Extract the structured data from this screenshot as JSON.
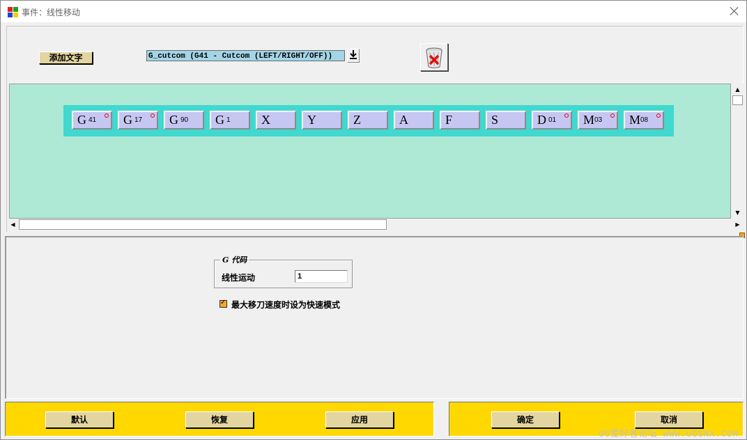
{
  "window": {
    "title": "事件：线性移动",
    "title_color": "#666666"
  },
  "toolbar": {
    "add_text_label": "添加文字",
    "dropdown_value": "G_cutcom (G41 - Cutcom (LEFT/RIGHT/OFF))",
    "dropdown_arrow_icon": "download-arrow-icon",
    "delete_icon": "trash-delete-icon"
  },
  "block": {
    "area_color": "#ade9d5",
    "strip_color": "#40d8cf",
    "word_color": "#c6c6f2",
    "words": [
      {
        "letter": "G",
        "sub": "41",
        "marked": true
      },
      {
        "letter": "G",
        "sub": "17",
        "marked": true
      },
      {
        "letter": "G",
        "sub": "90",
        "marked": false
      },
      {
        "letter": "G",
        "sub": "1",
        "marked": false
      },
      {
        "letter": "X",
        "sub": "",
        "marked": false
      },
      {
        "letter": "Y",
        "sub": "",
        "marked": false
      },
      {
        "letter": "Z",
        "sub": "",
        "marked": false
      },
      {
        "letter": "A",
        "sub": "",
        "marked": false
      },
      {
        "letter": "F",
        "sub": "",
        "marked": false
      },
      {
        "letter": "S",
        "sub": "",
        "marked": false
      },
      {
        "letter": "D",
        "sub": "01",
        "marked": true
      },
      {
        "letter": "M",
        "sub": "03",
        "marked": true
      },
      {
        "letter": "M",
        "sub": "08",
        "marked": true
      }
    ]
  },
  "gcode": {
    "group_title": "G 代码",
    "linear_motion_label": "线性运动",
    "linear_motion_value": "1"
  },
  "rapid": {
    "checked": true,
    "label": "最大移刀速度时设为快速模式"
  },
  "footer": {
    "color": "#ffd800",
    "default_label": "默认",
    "restore_label": "恢复",
    "apply_label": "应用",
    "ok_label": "确定",
    "cancel_label": "取消"
  },
  "watermark": "UG爱好者论坛 WWW.UGSNX.COM"
}
